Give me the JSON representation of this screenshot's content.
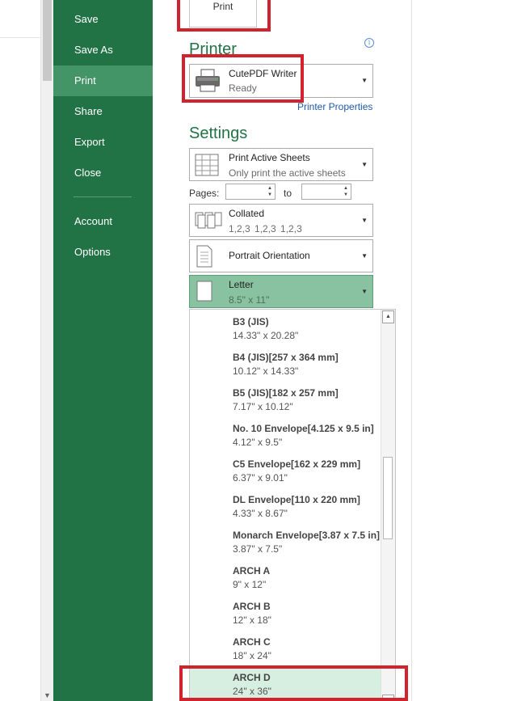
{
  "nav": {
    "items": [
      {
        "label": "Save"
      },
      {
        "label": "Save As"
      },
      {
        "label": "Print",
        "active": true
      },
      {
        "label": "Share"
      },
      {
        "label": "Export"
      },
      {
        "label": "Close"
      },
      {
        "label": "Account"
      },
      {
        "label": "Options"
      }
    ]
  },
  "print": {
    "button_label": "Print",
    "printer_heading": "Printer",
    "printer_name": "CutePDF Writer",
    "printer_status": "Ready",
    "printer_properties_link": "Printer Properties",
    "settings_heading": "Settings",
    "sheets": {
      "title": "Print Active Sheets",
      "subtitle": "Only print the active sheets"
    },
    "pages_label": "Pages:",
    "to_label": "to",
    "pages_from": "",
    "pages_to": "",
    "collation": {
      "title": "Collated",
      "subtitle": "1,2,3    1,2,3    1,2,3"
    },
    "orientation": {
      "title": "Portrait Orientation"
    },
    "paper": {
      "title": "Letter",
      "subtitle": "8.5\" x 11\""
    }
  },
  "paper_list": {
    "items": [
      {
        "name": "B3 (JIS)",
        "dims": "14.33\" x 20.28\""
      },
      {
        "name": "B4 (JIS)[257 x 364 mm]",
        "dims": "10.12\" x 14.33\""
      },
      {
        "name": "B5 (JIS)[182 x 257 mm]",
        "dims": "7.17\" x 10.12\""
      },
      {
        "name": "No. 10 Envelope[4.125 x 9.5 in]",
        "dims": "4.12\" x 9.5\""
      },
      {
        "name": "C5 Envelope[162 x 229 mm]",
        "dims": "6.37\" x 9.01\""
      },
      {
        "name": "DL Envelope[110 x 220 mm]",
        "dims": "4.33\" x 8.67\""
      },
      {
        "name": "Monarch Envelope[3.87 x 7.5 in]",
        "dims": "3.87\" x 7.5\""
      },
      {
        "name": "ARCH A",
        "dims": "9\" x 12\""
      },
      {
        "name": "ARCH B",
        "dims": "12\" x 18\""
      },
      {
        "name": "ARCH C",
        "dims": "18\" x 24\""
      },
      {
        "name": "ARCH D",
        "dims": "24\" x 36\"",
        "selected": true
      }
    ]
  },
  "colors": {
    "nav_green": "#217346",
    "nav_active": "#439467",
    "heading_green": "#217346",
    "highlight_red": "#d2222d",
    "selected_paper": "#88c2a0"
  }
}
